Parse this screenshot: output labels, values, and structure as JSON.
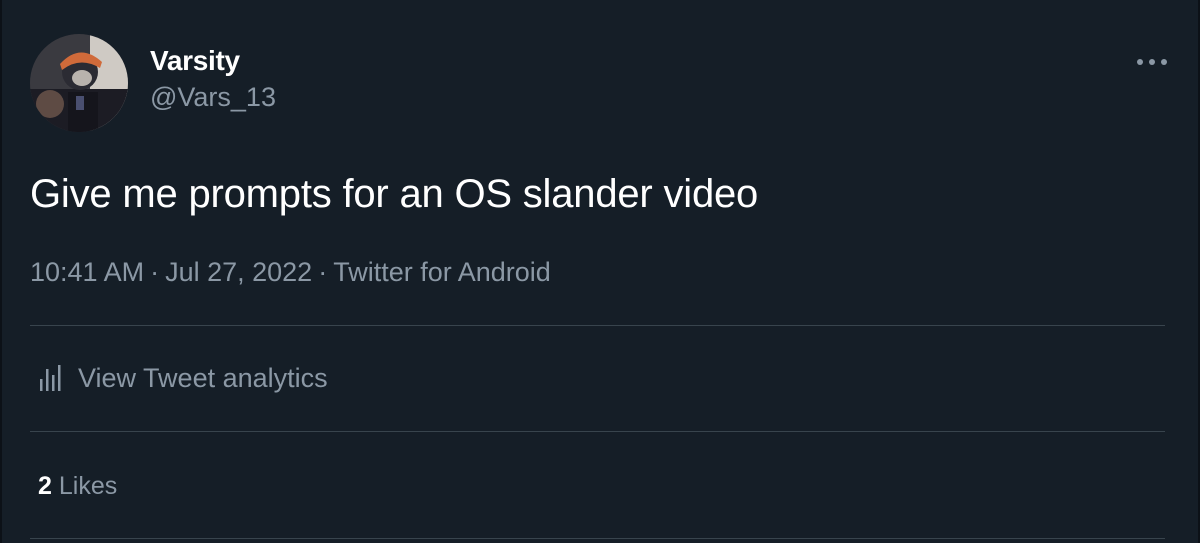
{
  "colors": {
    "background": "#151e27",
    "primary_text": "#ffffff",
    "secondary_text": "#8b98a5",
    "divider": "#38444d"
  },
  "author": {
    "display_name": "Varsity",
    "handle": "@Vars_13",
    "avatar_icon": "user-avatar-photo"
  },
  "tweet": {
    "text": "Give me prompts for an OS slander video",
    "time": "10:41 AM",
    "date": "Jul 27, 2022",
    "source": "Twitter for Android",
    "separator": "·"
  },
  "actions": {
    "more_icon": "more-horizontal-icon",
    "analytics_icon": "bar-chart-icon",
    "analytics_label": "View Tweet analytics"
  },
  "stats": {
    "likes_count": "2",
    "likes_label": "Likes"
  }
}
